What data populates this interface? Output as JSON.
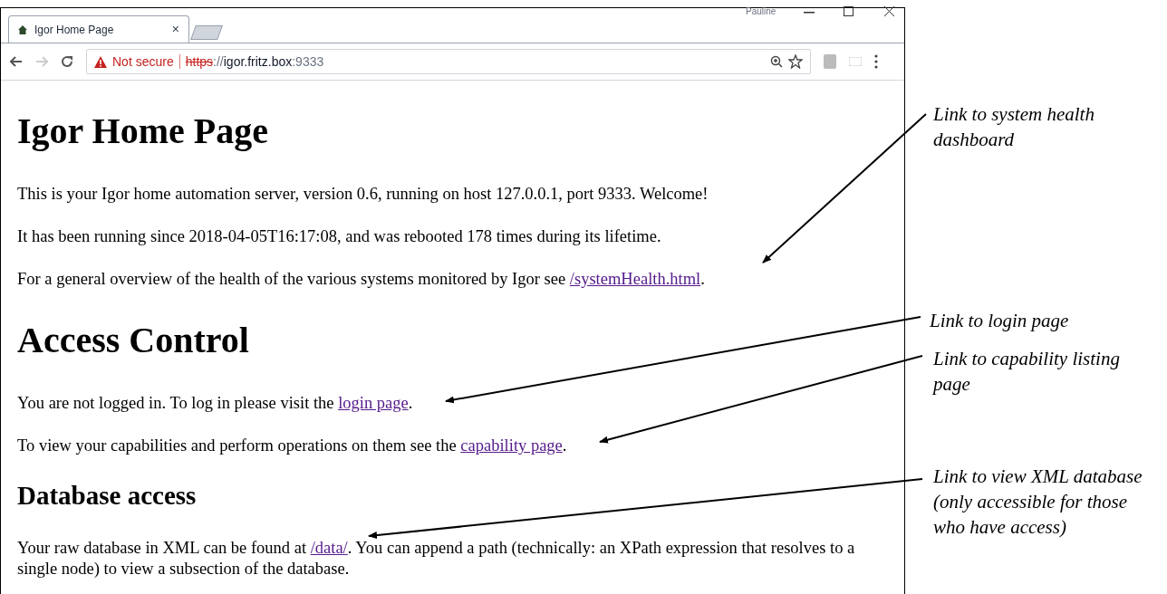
{
  "browser": {
    "tab": {
      "title": "Igor Home Page",
      "close": "×"
    },
    "profile": "Pauline",
    "address": {
      "warning": "Not secure",
      "scheme": "https",
      "rest_scheme": "://",
      "host": "igor.fritz.box",
      "port": ":9333"
    }
  },
  "page": [
    {
      "kind": "h1",
      "text": "Igor Home Page"
    },
    {
      "kind": "p",
      "parts": [
        {
          "kind": "text",
          "text": "This is your Igor home automation server, version 0.6, running on host 127.0.0.1, port 9333. Welcome!"
        }
      ]
    },
    {
      "kind": "p",
      "parts": [
        {
          "kind": "text",
          "text": "It has been running since 2018-04-05T16:17:08, and was rebooted 178 times during its lifetime."
        }
      ]
    },
    {
      "kind": "p",
      "parts": [
        {
          "kind": "text",
          "text": "For a general overview of the health of the various systems monitored by Igor see "
        },
        {
          "kind": "link",
          "text": "/systemHealth.html"
        },
        {
          "kind": "text",
          "text": "."
        }
      ]
    },
    {
      "kind": "h1",
      "text": "Access Control"
    },
    {
      "kind": "p",
      "parts": [
        {
          "kind": "text",
          "text": "You are not logged in. To log in please visit the "
        },
        {
          "kind": "link",
          "text": "login page"
        },
        {
          "kind": "text",
          "text": "."
        }
      ]
    },
    {
      "kind": "p",
      "parts": [
        {
          "kind": "text",
          "text": "To view your capabilities and perform operations on them see the "
        },
        {
          "kind": "link",
          "text": "capability page"
        },
        {
          "kind": "text",
          "text": "."
        }
      ]
    },
    {
      "kind": "h2",
      "text": "Database access"
    },
    {
      "kind": "p",
      "parts": [
        {
          "kind": "text",
          "text": "Your raw database in XML can be found at "
        },
        {
          "kind": "link",
          "text": "/data/"
        },
        {
          "kind": "text",
          "text": ". You can append a path (technically: an XPath expression that resolves to a single node) to view a subsection of the database."
        }
      ]
    }
  ],
  "annotations": [
    {
      "text": "Link to system health dashboard"
    },
    {
      "text": "Link to login page"
    },
    {
      "text": "Link to capability listing page"
    },
    {
      "text": "Link to view XML database (only accessible for those who have access)"
    }
  ]
}
